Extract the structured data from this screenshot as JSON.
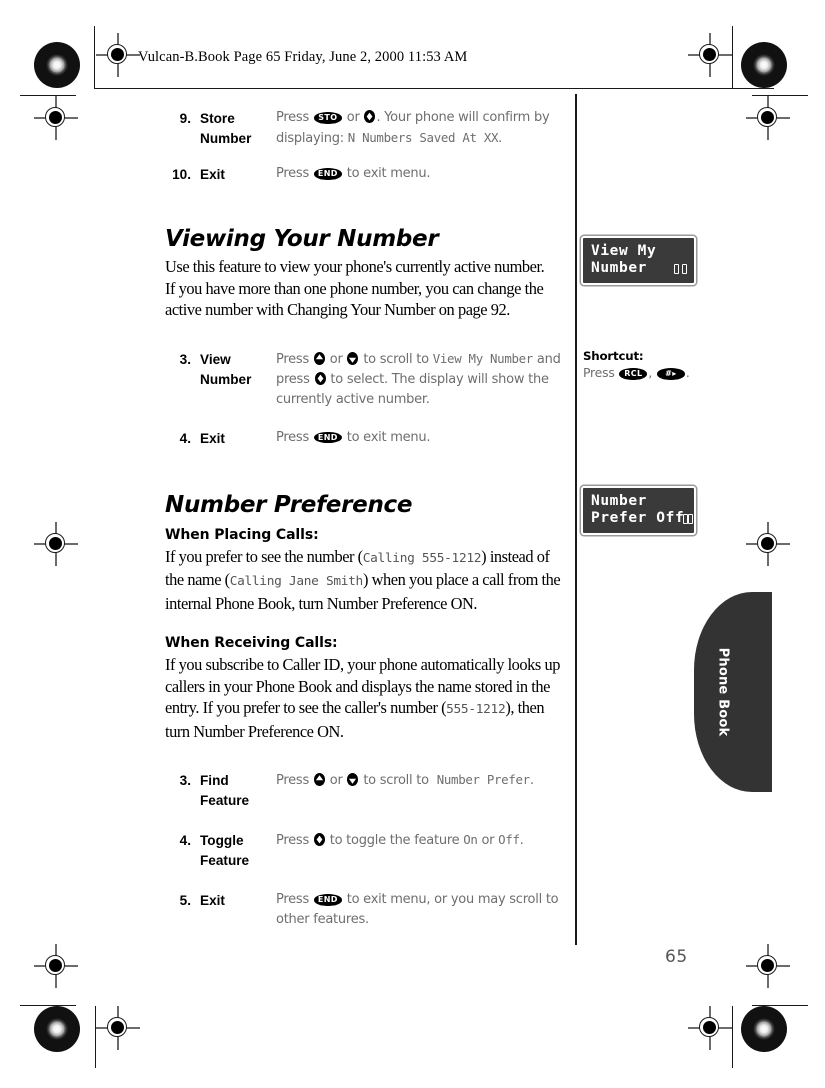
{
  "page": {
    "file_info": "Vulcan-B.Book  Page 65  Friday, June 2, 2000  11:53 AM",
    "page_number": "65",
    "side_tab_label": "Phone Book"
  },
  "top_steps": [
    {
      "num": "9.",
      "label_line1": "Store",
      "label_line2": "Number",
      "body_prefix": "Press ",
      "key1": "STO",
      "body_mid": " or ",
      "key2": "select-diamond",
      "body_suffix": ". Your phone will confirm by displaying: ",
      "lcd_text": "N Numbers Saved At XX",
      "body_end": "."
    },
    {
      "num": "10.",
      "label_line1": "Exit",
      "label_line2": "",
      "body_prefix": "Press ",
      "key1": "END",
      "body_suffix": " to exit menu."
    }
  ],
  "section_view": {
    "heading": "Viewing Your Number",
    "intro": "Use this feature to view your phone's currently active number. If you have more than one phone number, you can change the active number with Changing Your Number on page 92.",
    "steps": [
      {
        "num": "3.",
        "label_line1": "View",
        "label_line2": "Number",
        "part1": "Press ",
        "key_up": "up-arrow",
        "part2": " or ",
        "key_dn": "down-arrow",
        "part3": " to scroll to ",
        "lcd_text": "View My Number",
        "part4": " and press ",
        "key_sel": "select-diamond",
        "part5": " to select. The display will show the currently active number."
      },
      {
        "num": "4.",
        "label_line1": "Exit",
        "label_line2": "",
        "part1": "Press ",
        "key1": "END",
        "part2": " to exit menu."
      }
    ]
  },
  "section_pref": {
    "heading": "Number Preference",
    "sub1": "When Placing Calls:",
    "p1_a": "If you prefer to see the number (",
    "p1_lcd1": "Calling 555-1212",
    "p1_b": ") instead of the name (",
    "p1_lcd2": "Calling Jane Smith",
    "p1_c": ") when you place a call from the internal Phone Book, turn Number Preference ON.",
    "sub2": "When Receiving Calls:",
    "p2_a": "If you subscribe to Caller ID, your phone automatically looks up callers in your Phone Book and displays the name stored in the entry. If you prefer to see the caller's number (",
    "p2_lcd1": "555-1212",
    "p2_b": "), then turn Number Preference ON.",
    "steps": [
      {
        "num": "3.",
        "label_line1": "Find",
        "label_line2": "Feature",
        "part1": "Press ",
        "key_up": "up-arrow",
        "part2": " or ",
        "key_dn": "down-arrow",
        "part3": " to scroll to ",
        "lcd_text": "Number Prefer",
        "part4": "."
      },
      {
        "num": "4.",
        "label_line1": "Toggle",
        "label_line2": "Feature",
        "part1": "Press ",
        "key_sel": "select-diamond",
        "part2": " to toggle the feature ",
        "lcd_on": "On",
        "part3": " or ",
        "lcd_off": "Off",
        "part4": "."
      },
      {
        "num": "5.",
        "label_line1": "Exit",
        "label_line2": "",
        "part1": "Press ",
        "key1": "END",
        "part2": " to exit menu, or you may scroll to other features."
      }
    ]
  },
  "margin": {
    "lcd_box_1": {
      "line1": "View My",
      "line2": "Number",
      "icon": "phone-book-icon"
    },
    "lcd_box_2": {
      "line1": "Number",
      "line2": "Prefer Off",
      "icon": "phone-book-icon"
    },
    "shortcut": {
      "title": "Shortcut:",
      "press_word": "Press ",
      "key1": "RCL",
      "comma": ", ",
      "key2": "#",
      "period": "."
    }
  },
  "colors": {
    "lcd_bg": "#3a3a3a",
    "lcd_text": "#ffffff",
    "body_gray": "#6e6e6e",
    "tab_bg": "#333333"
  }
}
